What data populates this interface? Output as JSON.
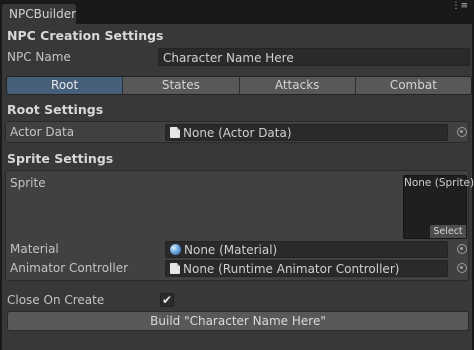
{
  "window": {
    "tab_title": "NPCBuilder",
    "menu_glyph": "⋮≡"
  },
  "npc_creation": {
    "header": "NPC Creation Settings",
    "npc_name_label": "NPC Name",
    "npc_name_value": "Character Name Here"
  },
  "toolbar": {
    "tabs": [
      {
        "label": "Root",
        "active": true
      },
      {
        "label": "States",
        "active": false
      },
      {
        "label": "Attacks",
        "active": false
      },
      {
        "label": "Combat",
        "active": false
      }
    ]
  },
  "root_settings": {
    "header": "Root Settings",
    "actor_data_label": "Actor Data",
    "actor_data_value": "None (Actor Data)"
  },
  "sprite_settings": {
    "header": "Sprite Settings",
    "sprite_label": "Sprite",
    "sprite_value": "None (Sprite)",
    "sprite_select": "Select",
    "material_label": "Material",
    "material_value": "None (Material)",
    "animator_label": "Animator Controller",
    "animator_value": "None (Runtime Animator Controller)"
  },
  "options": {
    "close_on_create_label": "Close On Create",
    "close_on_create_checked": true,
    "check_glyph": "✔"
  },
  "build_button": "Build \"Character Name Here\"",
  "colors": {
    "panel": "#383838",
    "active_tab": "#46607c",
    "button": "#585858"
  },
  "icons": {
    "actor_data": "document-icon",
    "material": "sphere-icon",
    "animator": "document-icon"
  }
}
